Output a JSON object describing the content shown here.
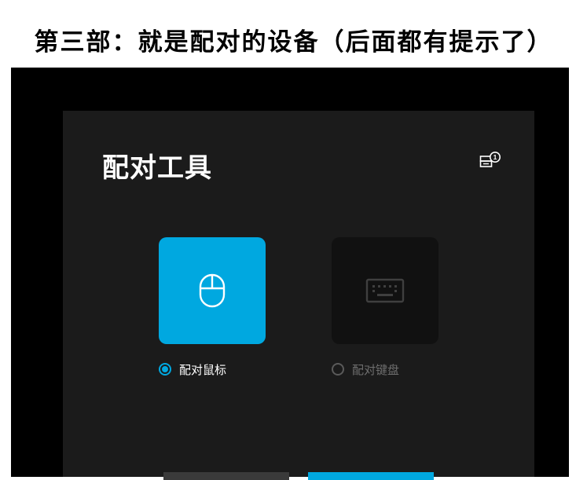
{
  "caption": "第三部：就是配对的设备（后面都有提示了）",
  "dialog": {
    "title": "配对工具",
    "devices_badge": "1",
    "options": {
      "mouse_label": "配对鼠标",
      "mouse_selected": true,
      "keyboard_label": "配对键盘",
      "keyboard_selected": false
    }
  },
  "colors": {
    "accent": "#00a8e0",
    "dialog_bg": "#1b1b1b",
    "outer_bg": "#000000",
    "disabled_text": "#6e6e6e"
  },
  "icons": {
    "devices": "devices-icon",
    "mouse": "mouse-icon",
    "keyboard": "keyboard-icon"
  }
}
